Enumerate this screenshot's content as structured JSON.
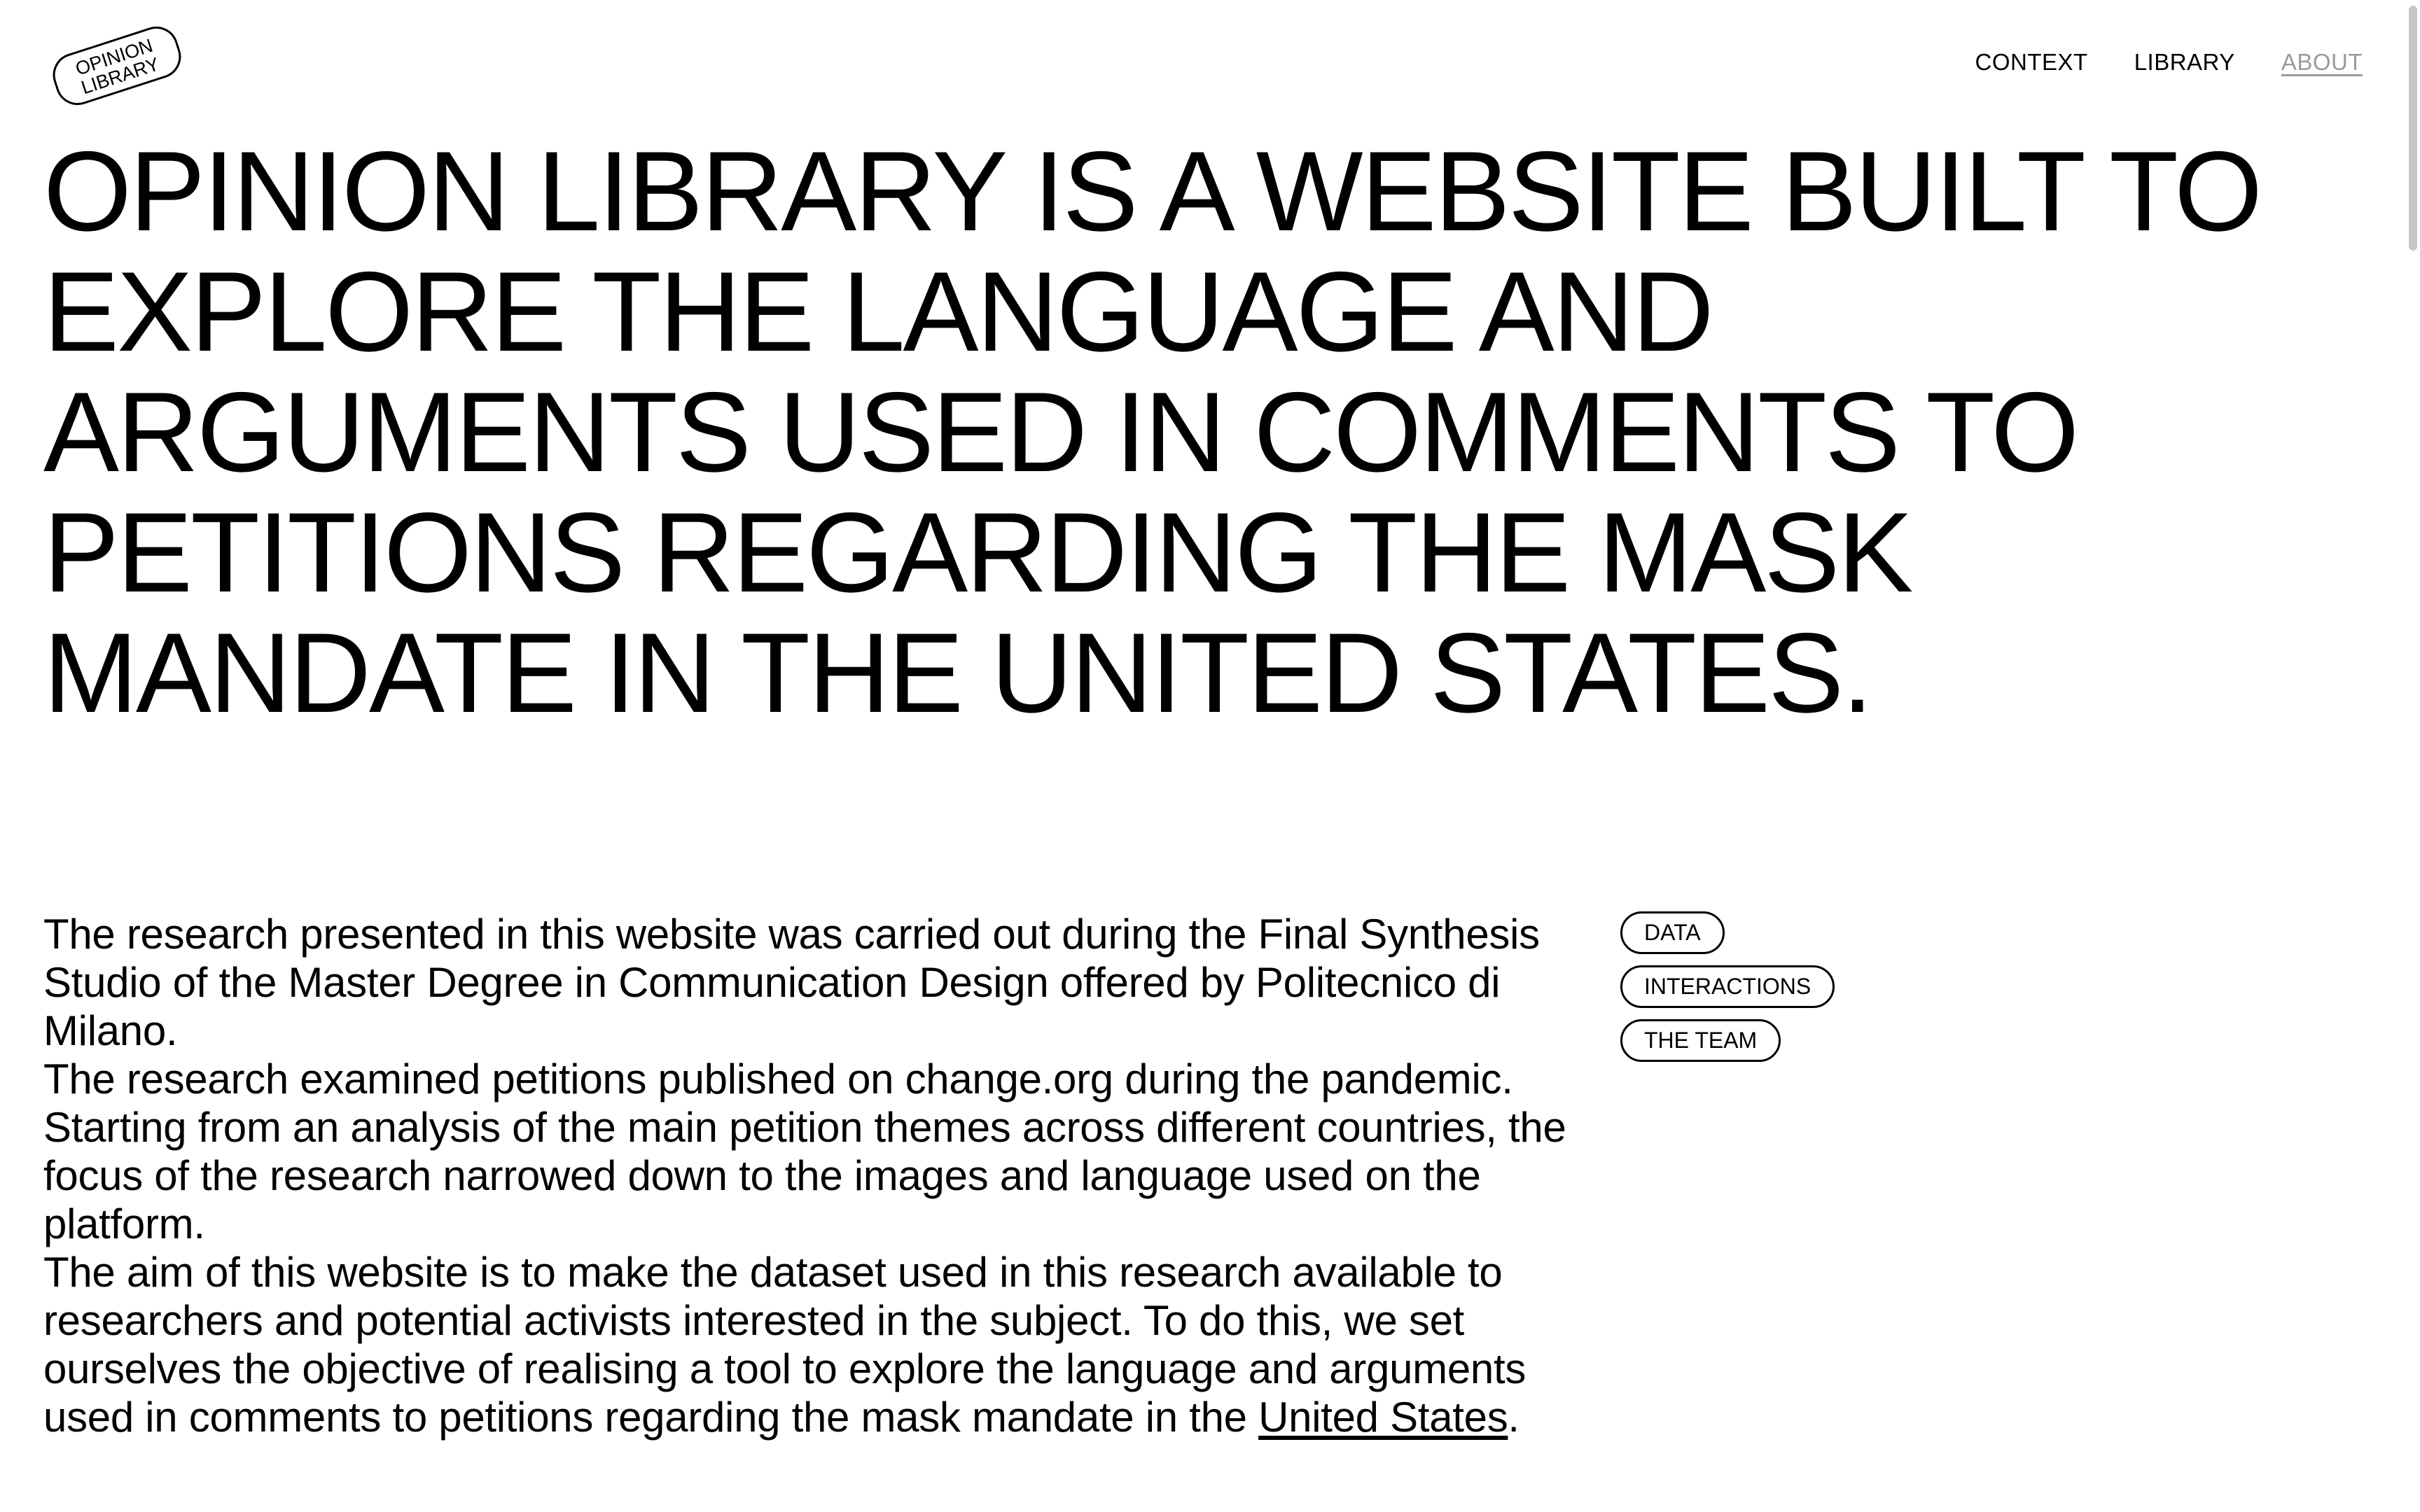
{
  "logo": {
    "line1": "OPINION",
    "line2": "LIBRARY"
  },
  "nav": {
    "items": [
      {
        "label": "CONTEXT"
      },
      {
        "label": "LIBRARY"
      },
      {
        "label": "ABOUT",
        "active": true
      }
    ]
  },
  "headline": "OPINION LIBRARY IS A WEBSITE BUILT TO EXPLORE THE LANGUAGE AND ARGUMENTS USED IN COMMENTS TO PETITIONS REGARDING THE MASK MANDATE IN THE UNITED STATES.",
  "body": {
    "p1": "The research presented in this website was carried out during the Final Synthesis Studio of the Master Degree in Communication Design offered by Politecnico di Milano.",
    "p2": "The research examined petitions published on change.org during the pandemic. Starting from an analysis of the main petition themes across different countries, the focus of the research narrowed down to the images and language used on the platform.",
    "p3_before_link": "The aim of this website is to make the dataset used in this research available to researchers and potential activists interested in the subject. To do this, we set ourselves the objective of realising a tool to explore the language and arguments used in comments to petitions regarding the mask mandate in the ",
    "p3_link": "United States",
    "p3_after_link": "."
  },
  "tags": [
    {
      "label": "DATA"
    },
    {
      "label": "INTERACTIONS"
    },
    {
      "label": "THE TEAM"
    }
  ],
  "colors": {
    "background": "#ffffff",
    "text": "#000000",
    "nav_active": "#9a9a9a",
    "scrollbar_thumb": "#c6c6c6"
  }
}
